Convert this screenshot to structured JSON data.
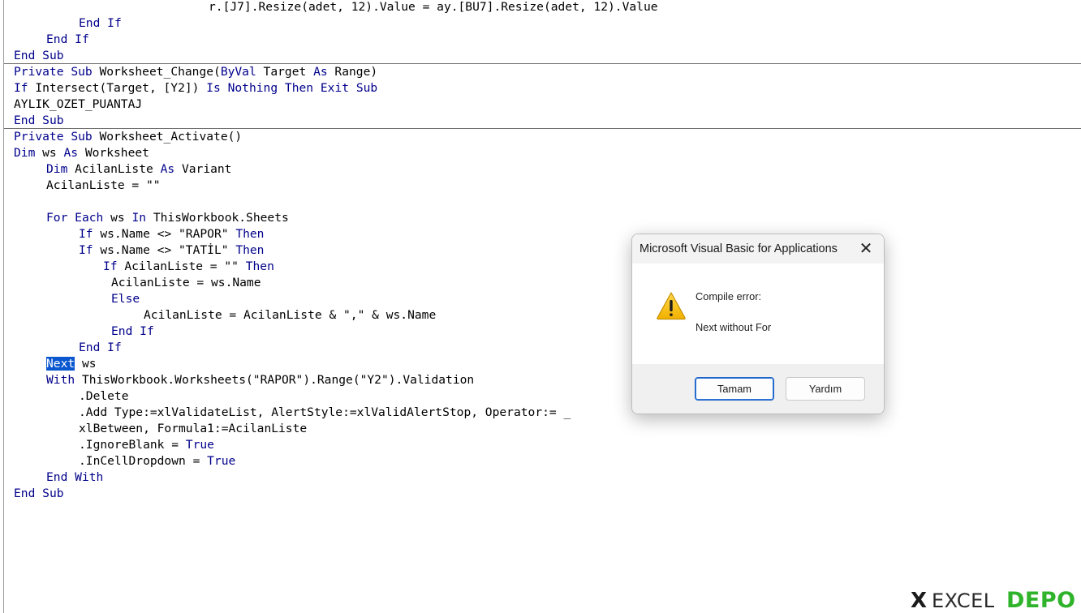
{
  "code": {
    "lines": [
      "r.[J7].Resize(adet, 12).Value = ay.[BU7].Resize(adet, 12).Value",
      "End If",
      "End If",
      "End Sub",
      "Private Sub Worksheet_Change(ByVal Target As Range)",
      "If Intersect(Target, [Y2]) Is Nothing Then Exit Sub",
      "AYLIK_OZET_PUANTAJ",
      "End Sub",
      "Private Sub Worksheet_Activate()",
      "Dim ws As Worksheet",
      "Dim AcilanListe As Variant",
      "AcilanListe = \"\"",
      "",
      "For Each ws In ThisWorkbook.Sheets",
      "If ws.Name <> \"RAPOR\" Then",
      "If ws.Name <> \"TATİL\" Then",
      "If AcilanListe = \"\" Then",
      "AcilanListe = ws.Name",
      "Else",
      "AcilanListe = AcilanListe & \",\" & ws.Name",
      "End If",
      "End If",
      "Next ws",
      "With ThisWorkbook.Worksheets(\"RAPOR\").Range(\"Y2\").Validation",
      ".Delete",
      ".Add Type:=xlValidateList, AlertStyle:=xlValidAlertStop, Operator:= _",
      "xlBetween, Formula1:=AcilanListe",
      ".IgnoreBlank = True",
      ".InCellDropdown = True",
      "End With",
      "End Sub"
    ],
    "selected_word": "Next"
  },
  "dialog": {
    "title": "Microsoft Visual Basic for Applications",
    "icon": "warning-icon",
    "message_heading": "Compile error:",
    "message_detail": "Next without For",
    "ok_label": "Tamam",
    "help_label": "Yardım",
    "close_glyph": "✕"
  },
  "watermark": {
    "mark": "X",
    "word_1": "EXCEL",
    "word_2": "DEPO"
  },
  "colors": {
    "keyword": "#00008b",
    "selection": "#0a57d0",
    "logo_green": "#2fb32a"
  }
}
